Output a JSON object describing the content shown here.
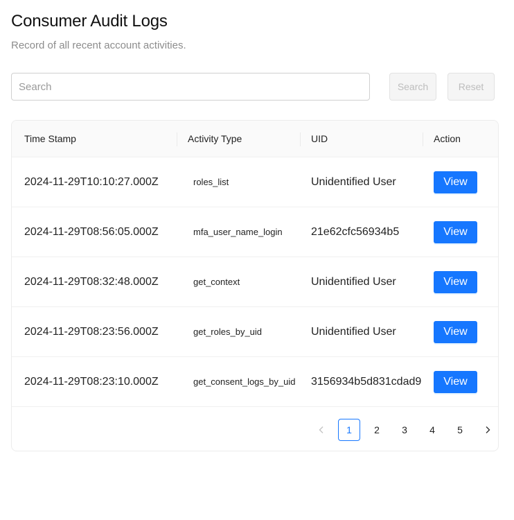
{
  "header": {
    "title": "Consumer Audit Logs",
    "subtitle": "Record of all recent account activities."
  },
  "search": {
    "placeholder": "Search",
    "value": "",
    "search_label": "Search",
    "reset_label": "Reset"
  },
  "table": {
    "columns": [
      "Time Stamp",
      "Activity Type",
      "UID",
      "Action"
    ],
    "rows": [
      {
        "time": "2024-11-29T10:10:27.000Z",
        "activity": "roles_list",
        "uid": "Unidentified User",
        "action": "View"
      },
      {
        "time": "2024-11-29T08:56:05.000Z",
        "activity": "mfa_user_name_login",
        "uid": "21e62cfc56934b5",
        "action": "View"
      },
      {
        "time": "2024-11-29T08:32:48.000Z",
        "activity": "get_context",
        "uid": "Unidentified User",
        "action": "View"
      },
      {
        "time": "2024-11-29T08:23:56.000Z",
        "activity": "get_roles_by_uid",
        "uid": "Unidentified User",
        "action": "View"
      },
      {
        "time": "2024-11-29T08:23:10.000Z",
        "activity": "get_consent_logs_by_uid",
        "uid": "3156934b5d831cdad9",
        "action": "View"
      }
    ]
  },
  "pagination": {
    "pages": [
      "1",
      "2",
      "3",
      "4",
      "5"
    ],
    "current": "1",
    "prev_icon": "chevron-left-icon",
    "next_icon": "chevron-right-icon"
  },
  "colors": {
    "primary": "#1677ff",
    "disabled_bg": "#f5f5f5",
    "disabled_text": "#bdbdbd",
    "header_bg": "#fafafa"
  }
}
